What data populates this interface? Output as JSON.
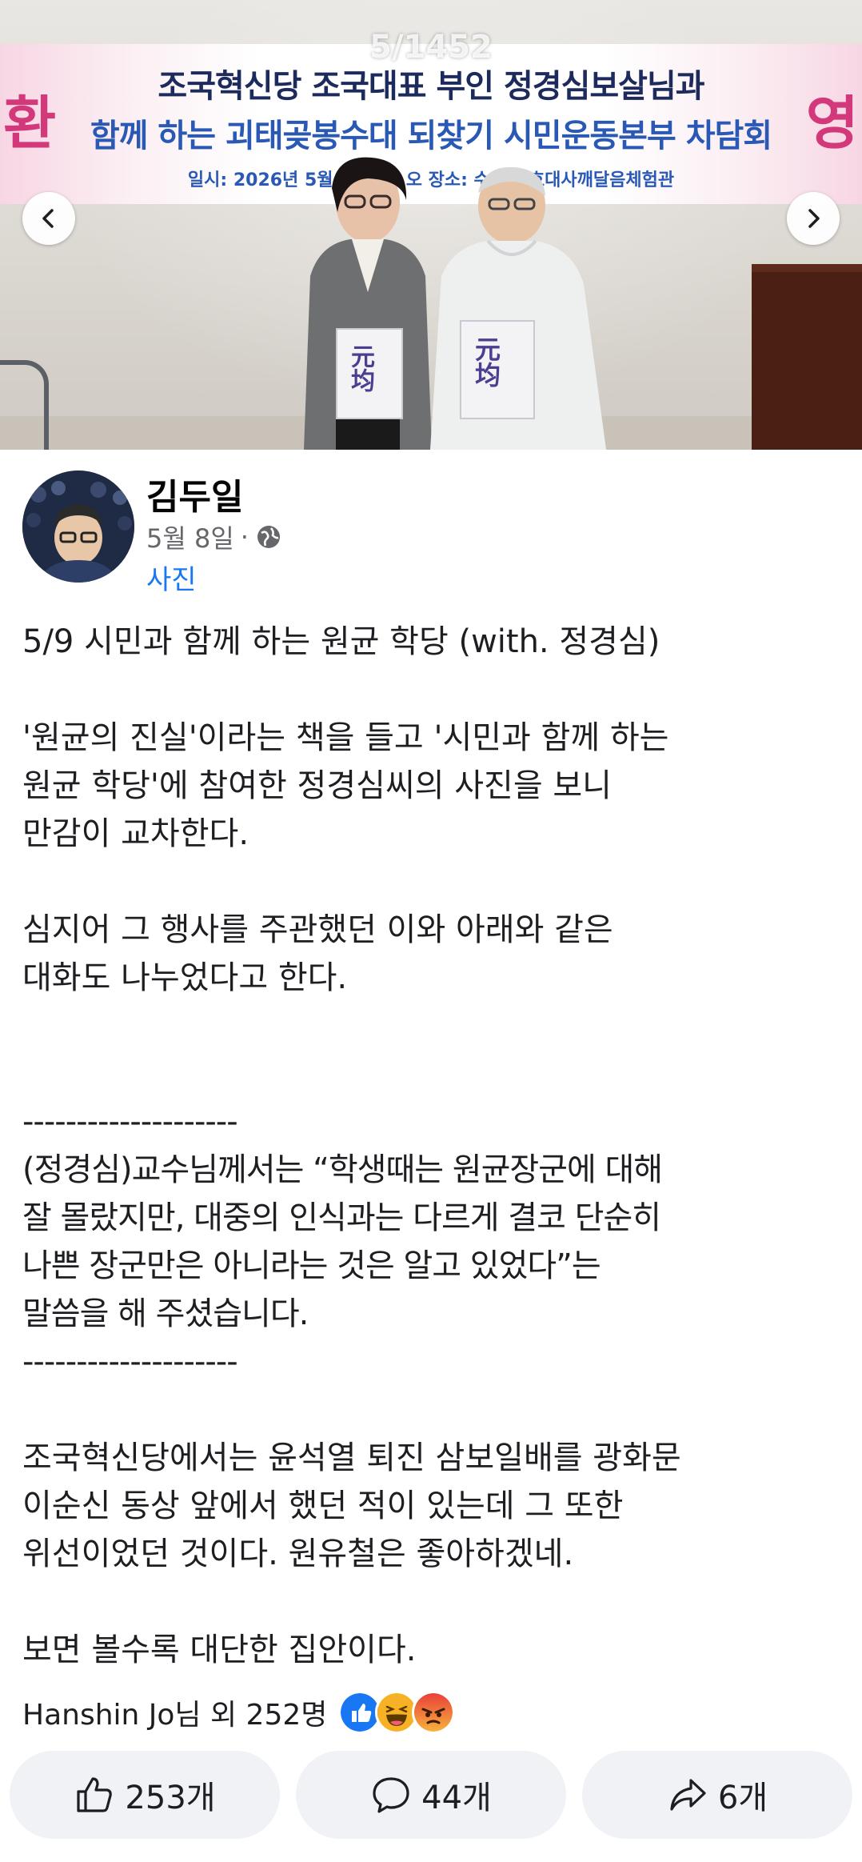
{
  "carousel": {
    "counter": "5/1452",
    "banner": {
      "line1": "조국혁신당 조국대표 부인 정경심보살님과",
      "line2": "함께 하는 괴태곶봉수대 되찾기 시민운동본부 차담회",
      "line3": "일시: 2026년 5월 6일(수) 오    장소: 수    택원효대사깨달음체험관",
      "side_left": "환",
      "side_right": "영"
    },
    "book_label_left": "元均",
    "book_label_right": "元均"
  },
  "post": {
    "author": "김두일",
    "date": "5월 8일",
    "date_separator": "·",
    "privacy_icon": "globe-icon",
    "category": "사진",
    "paragraphs": [
      "5/9 시민과 함께 하는 원균 학당 (with. 정경심)",
      "'원균의 진실'이라는 책을 들고 '시민과 함께 하는\n원균 학당'에 참여한 정경심씨의 사진을 보니\n만감이 교차한다.",
      "심지어 그 행사를 주관했던 이와 아래와 같은\n대화도 나누었다고 한다.",
      "--------------------\n(정경심)교수님께서는 “학생때는 원균장군에 대해\n잘 몰랐지만, 대중의 인식과는 다르게 결코 단순히\n나쁜 장군만은 아니라는 것은 알고 있었다”는\n말씀을 해 주셨습니다.\n--------------------",
      "조국혁신당에서는 윤석열 퇴진 삼보일배를 광화문\n이순신 동상 앞에서 했던 적이 있는데 그 또한\n위선이었던 것이다. 원유철은 좋아하겠네.",
      "보면 볼수록 대단한 집안이다."
    ]
  },
  "reactions": {
    "summary": "Hanshin Jo님 외 252명",
    "types": [
      "like",
      "haha",
      "angry"
    ],
    "colors": {
      "like": "#1877f2",
      "haha": "#f7b125",
      "angry": "#e9710f"
    }
  },
  "actions": {
    "like_count": "253개",
    "comment_count": "44개",
    "share_count": "6개"
  }
}
